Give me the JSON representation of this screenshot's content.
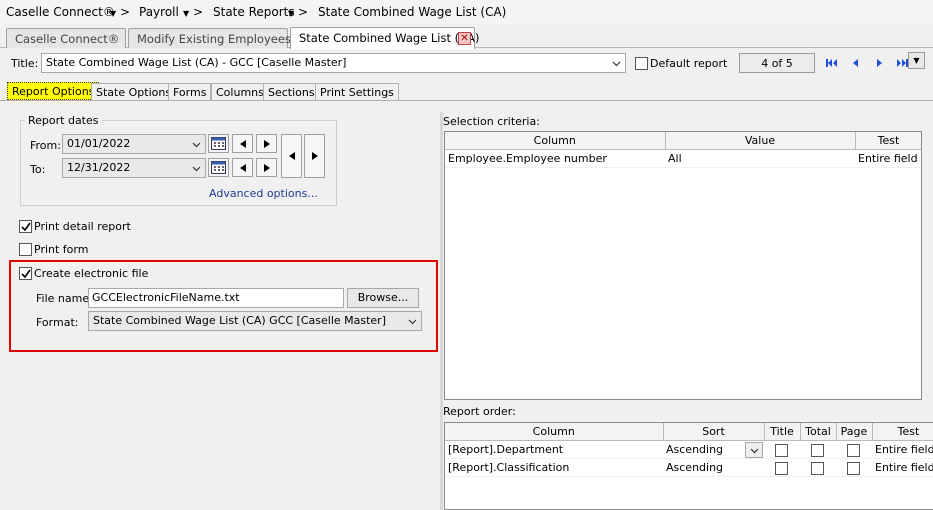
{
  "breadcrumb": {
    "app": "Caselle Connect®",
    "module": "Payroll",
    "section": "State Reports",
    "current": "State Combined Wage List (CA)"
  },
  "doc_tabs": [
    "Caselle Connect®",
    "Modify Existing Employees",
    "State Combined Wage List (CA)"
  ],
  "title_row": {
    "label": "Title:",
    "value": "State Combined Wage List (CA) - GCC [Caselle Master]",
    "default_report_label": "Default report",
    "pager": "4 of 5"
  },
  "option_tabs": [
    "Report Options",
    "State Options",
    "Forms",
    "Columns",
    "Sections",
    "Print Settings"
  ],
  "report_dates": {
    "title": "Report dates",
    "from_label": "From:",
    "from_value": "01/01/2022",
    "to_label": "To:",
    "to_value": "12/31/2022",
    "advanced_link": "Advanced options..."
  },
  "checkboxes": {
    "print_detail": {
      "label": "Print detail report",
      "checked": true
    },
    "print_form": {
      "label": "Print form",
      "checked": false
    },
    "create_electronic": {
      "label": "Create electronic file",
      "checked": true
    }
  },
  "electronic_file": {
    "file_name_label": "File name:",
    "file_name_value": "GCCElectronicFileName.txt",
    "browse_label": "Browse...",
    "format_label": "Format:",
    "format_value": "State Combined Wage List (CA) GCC [Caselle Master]"
  },
  "selection_criteria": {
    "title": "Selection criteria:",
    "headers": [
      "Column",
      "Value",
      "Test"
    ],
    "rows": [
      [
        "Employee.Employee number",
        "All",
        "Entire field"
      ]
    ]
  },
  "report_order": {
    "title": "Report order:",
    "headers": [
      "Column",
      "Sort",
      "Title",
      "Total",
      "Page",
      "Test"
    ],
    "rows": [
      [
        "[Report].Department",
        "Ascending",
        "Entire field"
      ],
      [
        "[Report].Classification",
        "Ascending",
        "Entire field"
      ]
    ]
  },
  "colors": {
    "highlight": "#e00000",
    "active_tab": "#ffff00",
    "link": "#1c3b96",
    "nav": "#1f4fd6"
  }
}
